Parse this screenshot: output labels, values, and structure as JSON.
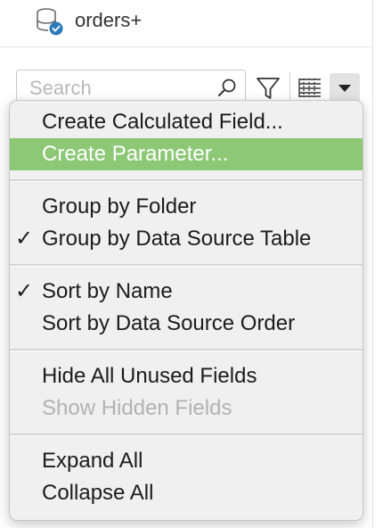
{
  "datasource": {
    "name": "orders+",
    "icon": "database-check-icon"
  },
  "search": {
    "placeholder": "Search",
    "value": ""
  },
  "toolbar": {
    "filter_icon": "filter-icon",
    "view_icon": "list-view-icon",
    "menu_icon": "chevron-down-icon"
  },
  "menu": {
    "highlight_color": "#8dc877",
    "groups": [
      [
        {
          "label": "Create Calculated Field...",
          "checked": false,
          "highlighted": false,
          "enabled": true
        },
        {
          "label": "Create Parameter...",
          "checked": false,
          "highlighted": true,
          "enabled": true
        }
      ],
      [
        {
          "label": "Group by Folder",
          "checked": false,
          "highlighted": false,
          "enabled": true
        },
        {
          "label": "Group by Data Source Table",
          "checked": true,
          "highlighted": false,
          "enabled": true
        }
      ],
      [
        {
          "label": "Sort by Name",
          "checked": true,
          "highlighted": false,
          "enabled": true
        },
        {
          "label": "Sort by Data Source Order",
          "checked": false,
          "highlighted": false,
          "enabled": true
        }
      ],
      [
        {
          "label": "Hide All Unused Fields",
          "checked": false,
          "highlighted": false,
          "enabled": true
        },
        {
          "label": "Show Hidden Fields",
          "checked": false,
          "highlighted": false,
          "enabled": false
        }
      ],
      [
        {
          "label": "Expand All",
          "checked": false,
          "highlighted": false,
          "enabled": true
        },
        {
          "label": "Collapse All",
          "checked": false,
          "highlighted": false,
          "enabled": true
        }
      ]
    ],
    "check_glyph": "✓"
  }
}
